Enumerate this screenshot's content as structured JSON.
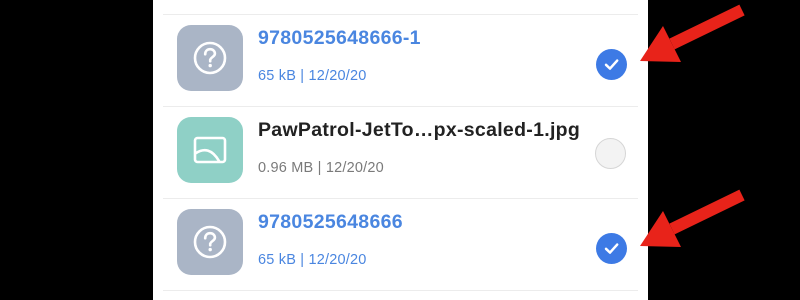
{
  "files": [
    {
      "name": "9780525648666-1",
      "meta": "65 kB | 12/20/20",
      "type_icon": "unknown-file-icon",
      "selected": true
    },
    {
      "name": "PawPatrol-JetTo…px-scaled-1.jpg",
      "meta": "0.96 MB | 12/20/20",
      "type_icon": "image-file-icon",
      "selected": false
    },
    {
      "name": "9780525648666",
      "meta": "65 kB | 12/20/20",
      "type_icon": "unknown-file-icon",
      "selected": true
    }
  ],
  "colors": {
    "selected_text": "#4a86e0",
    "unselected_name": "#222222",
    "unselected_meta": "#7a7a7a",
    "unknown_thumb_bg": "#aab5c6",
    "image_thumb_bg": "#8fd0c6",
    "check_blue": "#3d7ae5",
    "annotation_arrow": "#e8231a"
  }
}
